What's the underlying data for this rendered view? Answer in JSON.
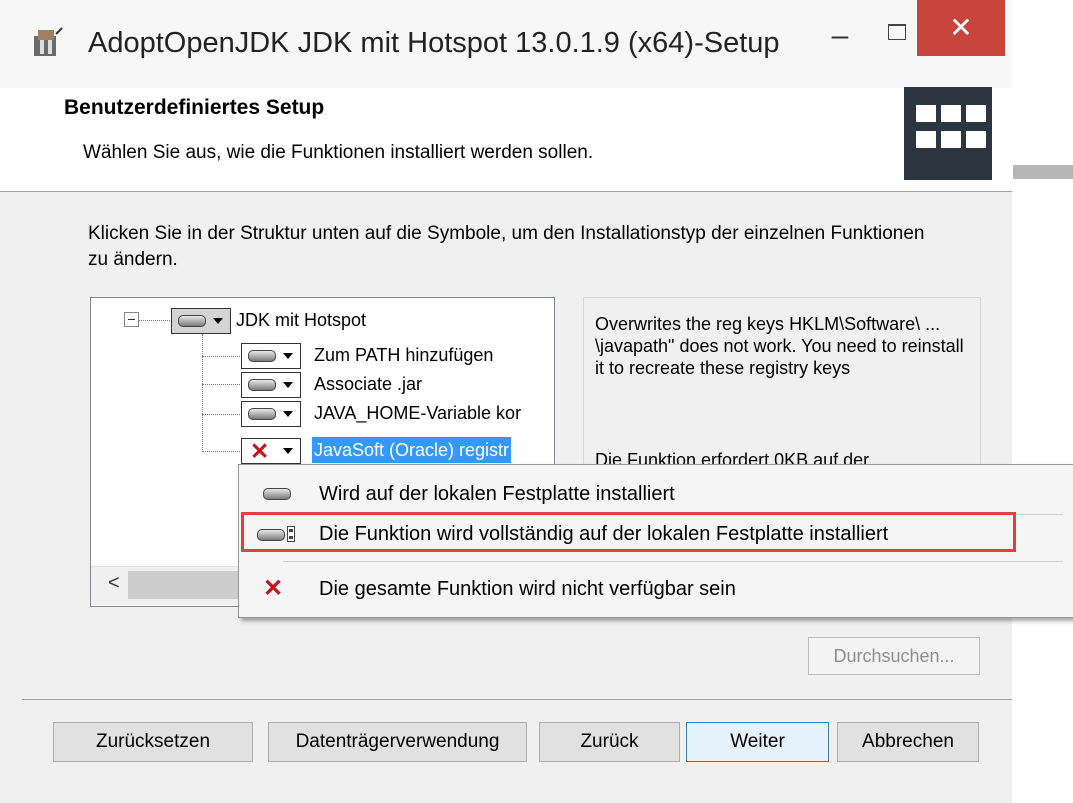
{
  "window": {
    "title": "AdoptOpenJDK JDK mit Hotspot 13.0.1.9 (x64)-Setup",
    "minimize_symbol": "–",
    "close_symbol": "✕"
  },
  "header": {
    "title": "Benutzerdefiniertes Setup",
    "subtitle": "Wählen Sie aus, wie die Funktionen installiert werden sollen."
  },
  "instructions": "Klicken Sie in der Struktur unten auf die Symbole, um den Installationstyp der einzelnen Funktionen zu ändern.",
  "tree": {
    "root": {
      "label": "JDK mit Hotspot",
      "icon": "hard-drive-icon"
    },
    "children": [
      {
        "label": "Zum PATH hinzufügen",
        "icon": "hard-drive-icon"
      },
      {
        "label": "Associate .jar",
        "icon": "hard-drive-icon"
      },
      {
        "label": "JAVA_HOME-Variable kor",
        "icon": "hard-drive-icon"
      },
      {
        "label": "JavaSoft (Oracle) registr",
        "icon": "red-x-icon",
        "selected": true
      }
    ],
    "scroll_left_symbol": "<"
  },
  "description": {
    "text": "Overwrites the reg keys HKLM\\Software\\ ... \\javapath\" does not work. You need to reinstall it to recreate these registry keys",
    "requirement": "Die Funktion erfordert 0KB auf der"
  },
  "menu": {
    "items": [
      {
        "label": "Wird auf der lokalen Festplatte installiert",
        "icon": "hard-drive-icon"
      },
      {
        "label": "Die Funktion wird vollständig auf der lokalen Festplatte installiert",
        "icon": "hard-drive-full-icon",
        "highlighted": true
      },
      {
        "label": "Die gesamte Funktion wird nicht verfügbar sein",
        "icon": "red-x-icon"
      }
    ]
  },
  "buttons": {
    "browse": "Durchsuchen...",
    "reset": "Zurücksetzen",
    "disk_usage": "Datenträgerverwendung",
    "back": "Zurück",
    "next": "Weiter",
    "cancel": "Abbrechen"
  },
  "colors": {
    "close": "#c7453a",
    "selection": "#3399ff",
    "highlight_box": "#e04040",
    "x_mark": "#c0141e"
  }
}
